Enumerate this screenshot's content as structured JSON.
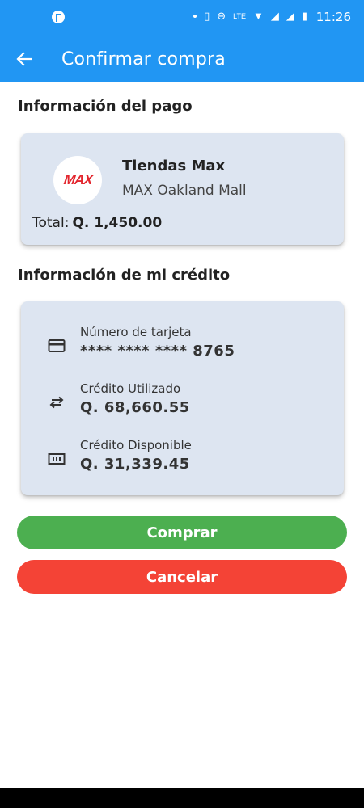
{
  "status_bar": {
    "network": "LTE",
    "time": "11:26"
  },
  "app_bar": {
    "title": "Confirmar compra"
  },
  "payment_section": {
    "title": "Información del pago",
    "logo_text": "MAX",
    "store_name": "Tiendas Max",
    "store_branch": "MAX Oakland Mall",
    "total_label": "Total:",
    "total_amount": "Q. 1,450.00"
  },
  "credit_section": {
    "title": "Información de mi crédito",
    "items": [
      {
        "label": "Número de tarjeta",
        "value": "**** **** **** 8765",
        "icon": "credit-card-icon"
      },
      {
        "label": "Crédito Utilizado",
        "value": "Q.  68,660.55",
        "icon": "swap-arrows-icon"
      },
      {
        "label": "Crédito Disponible",
        "value": "Q.  31,339.45",
        "icon": "money-icon"
      }
    ]
  },
  "actions": {
    "confirm_label": "Comprar",
    "cancel_label": "Cancelar"
  },
  "colors": {
    "primary": "#2196F3",
    "card_bg": "#dde5f1",
    "confirm": "#4caf50",
    "cancel": "#f44336",
    "brand_red": "#e3262e"
  }
}
